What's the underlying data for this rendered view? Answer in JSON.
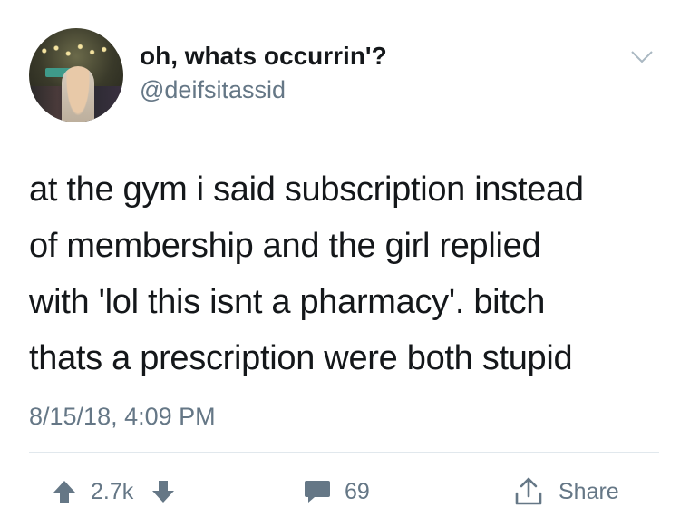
{
  "tweet": {
    "display_name": "oh, whats occurrin'?",
    "handle": "@deifsitassid",
    "text_lines": [
      "at the gym i said subscription instead",
      "of membership and the girl replied",
      "with 'lol this isnt a pharmacy'. bitch",
      "thats a prescription were both stupid"
    ],
    "timestamp": "8/15/18, 4:09 PM"
  },
  "actions": {
    "upvote_count": "2.7k",
    "reply_count": "69",
    "share_label": "Share"
  },
  "icons": {
    "more": "chevron-down-icon",
    "upvote": "arrow-up-icon",
    "downvote": "arrow-down-icon",
    "reply": "comment-icon",
    "share": "share-icon"
  },
  "colors": {
    "text": "#14171a",
    "secondary": "#657786",
    "divider": "#e1e8ed"
  }
}
